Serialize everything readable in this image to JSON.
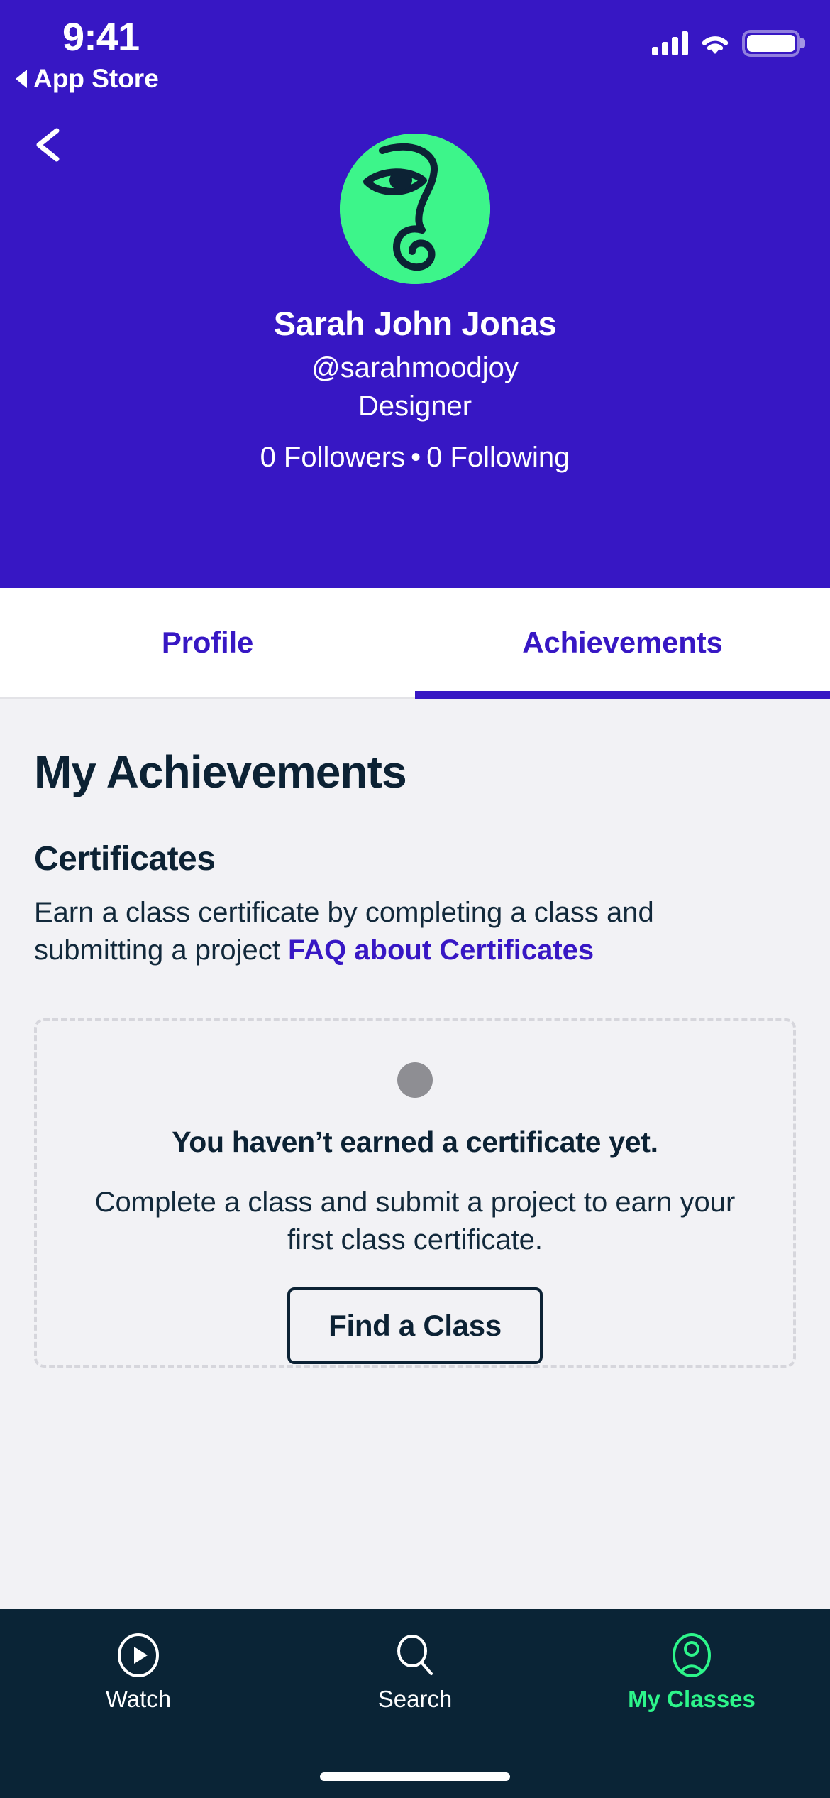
{
  "status_bar": {
    "time": "9:41",
    "return_label": "App Store",
    "icons": [
      "back-triangle-icon",
      "cellular-signal-icon",
      "wifi-icon",
      "battery-icon"
    ]
  },
  "header": {
    "back_icon": "chevron-left-icon",
    "avatar_alt": "abstract-face-avatar",
    "name": "Sarah John Jonas",
    "handle": "@sarahmoodjoy",
    "role": "Designer",
    "followers": "0 Followers",
    "separator": "•",
    "following": "0 Following"
  },
  "tabs": [
    {
      "label": "Profile",
      "active": false
    },
    {
      "label": "Achievements",
      "active": true
    }
  ],
  "main": {
    "page_title": "My Achievements",
    "section_title": "Certificates",
    "section_desc_text": "Earn a class certificate by completing a class and submitting a project ",
    "section_desc_link": "FAQ about Certificates",
    "empty_state": {
      "icon": "gray-circle-placeholder-icon",
      "title": "You haven’t earned a certificate yet.",
      "body": "Complete a class and submit a project to earn your first class certificate.",
      "button_label": "Find a Class"
    }
  },
  "bottom_nav": [
    {
      "label": "Watch",
      "icon": "play-circle-icon",
      "active": false
    },
    {
      "label": "Search",
      "icon": "search-icon",
      "active": false
    },
    {
      "label": "My Classes",
      "icon": "person-circle-icon",
      "active": true
    }
  ],
  "colors": {
    "brand_purple": "#3717C4",
    "accent_green": "#3DF58A",
    "nav_dark": "#0A2436",
    "page_bg": "#F2F2F5",
    "text_navy": "#0C2234",
    "dashed_border": "#D6D6DC",
    "placeholder_gray": "#8E8E93"
  }
}
